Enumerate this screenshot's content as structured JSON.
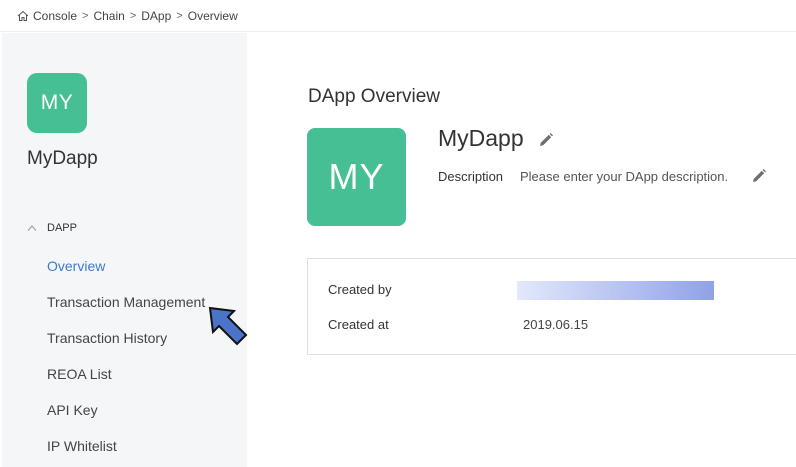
{
  "breadcrumb": {
    "items": [
      "Console",
      "Chain",
      "DApp",
      "Overview"
    ],
    "separator": ">"
  },
  "sidebar": {
    "avatar_text": "MY",
    "app_name": "MyDapp",
    "section_label": "DAPP",
    "items": [
      {
        "label": "Overview",
        "active": true
      },
      {
        "label": "Transaction Management",
        "active": false
      },
      {
        "label": "Transaction History",
        "active": false
      },
      {
        "label": "REOA List",
        "active": false
      },
      {
        "label": "API Key",
        "active": false
      },
      {
        "label": "IP Whitelist",
        "active": false
      }
    ]
  },
  "main": {
    "title": "DApp Overview",
    "avatar_text": "MY",
    "dapp_name": "MyDapp",
    "description_label": "Description",
    "description_placeholder": "Please enter your DApp description.",
    "info": {
      "created_by_label": "Created by",
      "created_by_value": "",
      "created_at_label": "Created at",
      "created_at_value": "2019.06.15"
    }
  },
  "colors": {
    "brand_green": "#45bf93",
    "active_link": "#3a7bd5",
    "sidebar_bg": "#f5f6f8",
    "cursor_fill": "#4a74c9"
  },
  "icons": [
    "home-icon",
    "chevron-up-icon",
    "pencil-icon",
    "cursor-arrow-icon"
  ]
}
